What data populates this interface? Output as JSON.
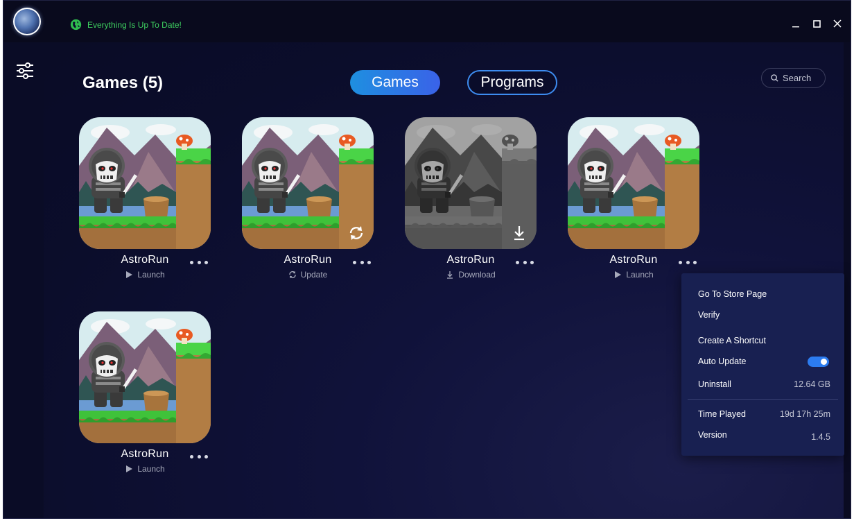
{
  "titlebar": {
    "status_text": "Everything Is Up To Date!",
    "status_color": "#3ed160"
  },
  "header": {
    "title": "Games (5)",
    "tabs": [
      {
        "label": "Games",
        "active": true
      },
      {
        "label": "Programs",
        "active": false
      }
    ],
    "search_label": "Search"
  },
  "games": [
    {
      "title": "AstroRun",
      "action": "Launch",
      "action_icon": "play-icon",
      "state": "installed"
    },
    {
      "title": "AstroRun",
      "action": "Update",
      "action_icon": "refresh-icon",
      "state": "update"
    },
    {
      "title": "AstroRun",
      "action": "Download",
      "action_icon": "download-icon",
      "state": "not-installed"
    },
    {
      "title": "AstroRun",
      "action": "Launch",
      "action_icon": "play-icon",
      "state": "installed"
    },
    {
      "title": "AstroRun",
      "action": "Launch",
      "action_icon": "play-icon",
      "state": "installed"
    }
  ],
  "context_menu": {
    "store_page": "Go To Store Page",
    "verify": "Verify",
    "shortcut": "Create A Shortcut",
    "auto_update": "Auto Update",
    "auto_update_on": true,
    "uninstall": "Uninstall",
    "uninstall_size": "12.64 GB",
    "time_played_label": "Time Played",
    "time_played_value": "19d 17h 25m",
    "version_label": "Version",
    "version_value": "1.4.5"
  },
  "colors": {
    "accent": "#2c7cf0",
    "tab_gradient_start": "#1e8fe0",
    "tab_gradient_end": "#3a62e8",
    "menu_bg": "#182051"
  }
}
